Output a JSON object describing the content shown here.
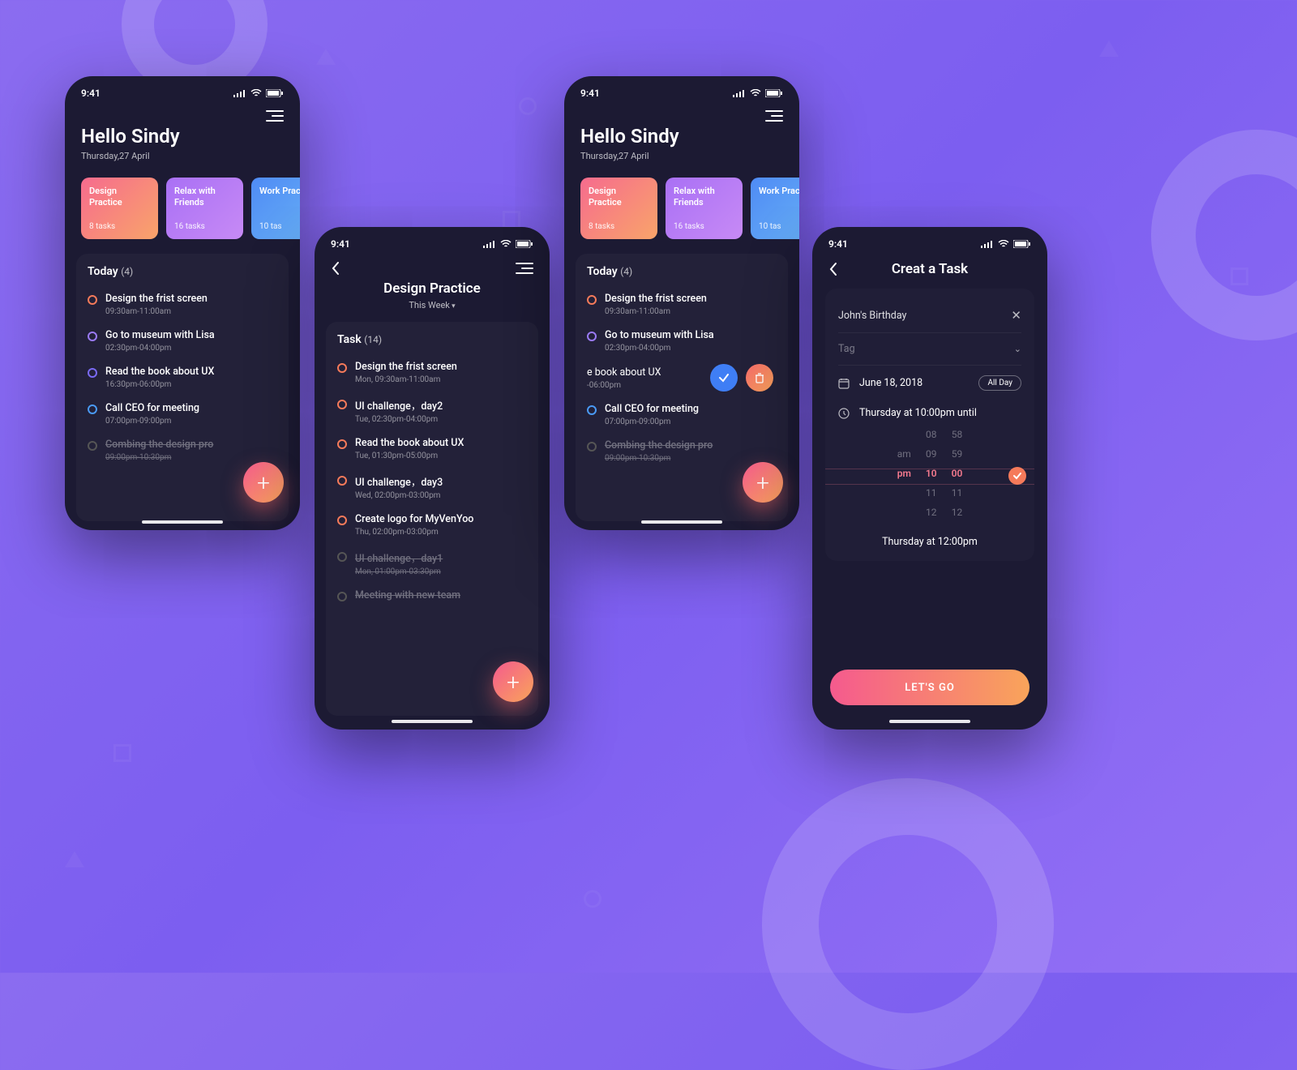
{
  "status_time": "9:41",
  "common": {
    "menu": "≡"
  },
  "home": {
    "greeting": "Hello Sindy",
    "date": "Thursday,27 April",
    "categories": [
      {
        "title": "Design Practice",
        "count": "8 tasks"
      },
      {
        "title": "Relax with Friends",
        "count": "16 tasks"
      },
      {
        "title": "Work Pract",
        "count": "10 tas"
      }
    ],
    "today_title": "Today",
    "today_count": "(4)",
    "tasks": [
      {
        "name": "Design the frist screen",
        "time": "09:30am-11:00am",
        "color": "orange"
      },
      {
        "name": "Go to museum with Lisa",
        "time": "02:30pm-04:00pm",
        "color": "purple"
      },
      {
        "name": "Read the book about UX",
        "time": "16:30pm-06:00pm",
        "color": "purple2"
      },
      {
        "name": "Call CEO for meeting",
        "time": "07:00pm-09:00pm",
        "color": "blue"
      },
      {
        "name": "Combing the design pro",
        "time": "09:00pm-10:30pm",
        "color": "done",
        "done": true
      }
    ]
  },
  "detail": {
    "title": "Design Practice",
    "filter": "This Week",
    "list_title": "Task",
    "list_count": "(14)",
    "tasks": [
      {
        "name": "Design the frist screen",
        "time": "Mon, 09:30am-11:00am"
      },
      {
        "name": "UI challenge，day2",
        "time": "Tue, 02:30pm-04:00pm"
      },
      {
        "name": "Read the book about UX",
        "time": "Tue, 01:30pm-05:00pm"
      },
      {
        "name": "UI challenge，day3",
        "time": "Wed, 02:00pm-03:00pm"
      },
      {
        "name": "Create logo for MyVenYoo",
        "time": "Thu, 02:00pm-03:00pm"
      },
      {
        "name": "UI challenge，day1",
        "time": "Mon, 01:00pm-03:30pm",
        "done": true
      },
      {
        "name": "Meeting with new team",
        "time": "",
        "done": true
      }
    ]
  },
  "swipe": {
    "partial_name": "e book about UX",
    "partial_time": "-06:00pm"
  },
  "create": {
    "title": "Creat a Task",
    "task_name": "John's Birthday",
    "tag_label": "Tag",
    "date_value": "June 18, 2018",
    "allday_label": "All Day",
    "time_label": "Thursday at 10:00pm until",
    "picker": {
      "ampm": [
        "am",
        "pm"
      ],
      "ampm_sel": "pm",
      "hours": [
        "08",
        "09",
        "10",
        "11",
        "12"
      ],
      "hours_sel": "10",
      "mins": [
        "58",
        "59",
        "00",
        "11",
        "12"
      ],
      "mins_sel": "00"
    },
    "result": "Thursday at 12:00pm",
    "cta": "LET'S GO"
  }
}
